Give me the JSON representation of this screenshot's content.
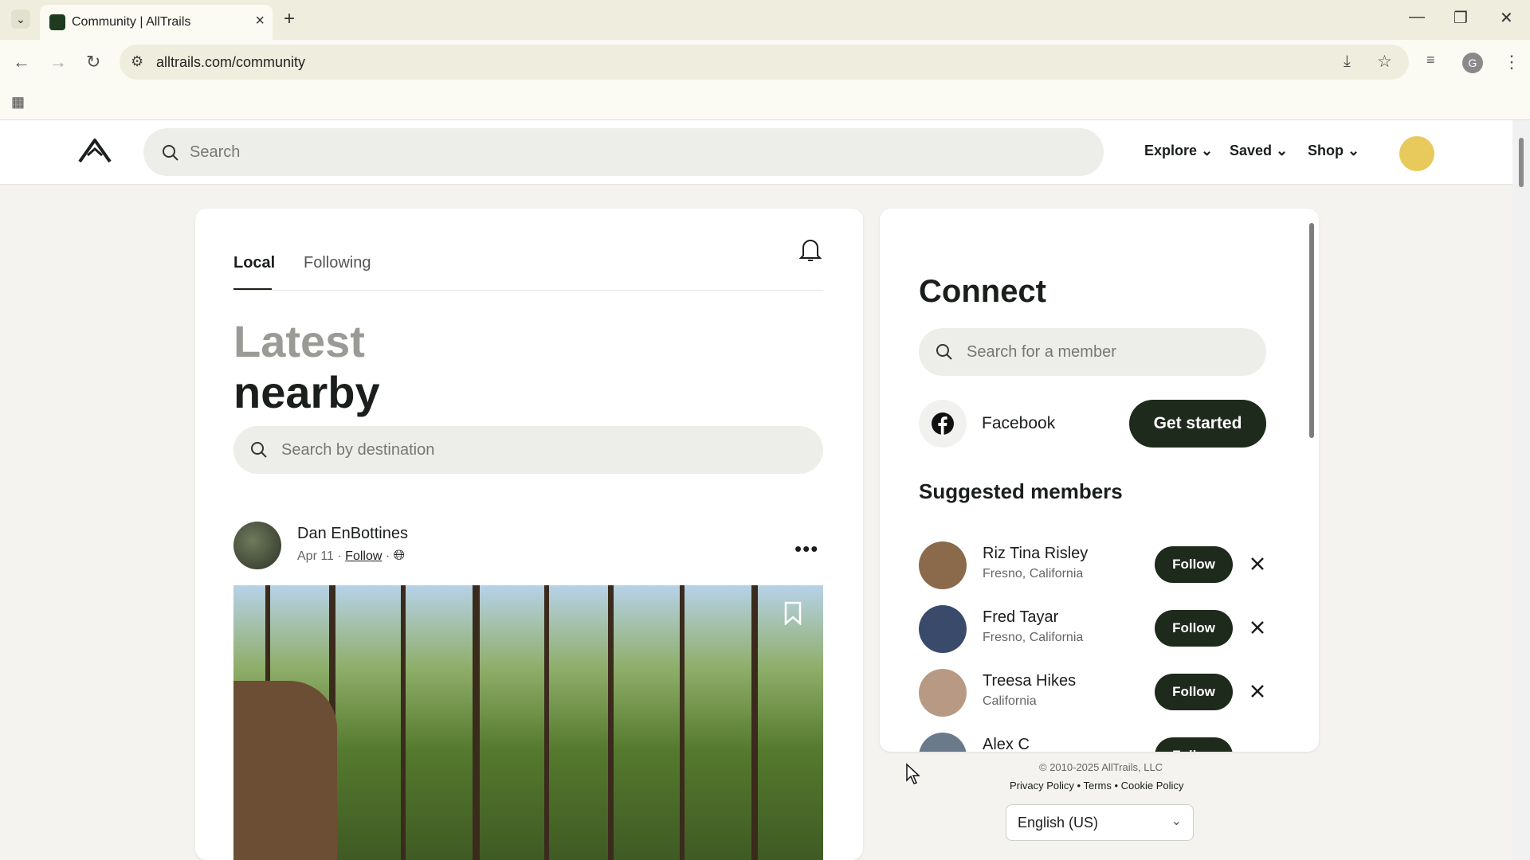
{
  "browser": {
    "tab_title": "Community | AllTrails",
    "url": "alltrails.com/community",
    "profile_initial": "G"
  },
  "header": {
    "search_placeholder": "Search",
    "nav": [
      "Explore",
      "Saved",
      "Shop"
    ]
  },
  "feed": {
    "tabs": [
      "Local",
      "Following"
    ],
    "heading_line1": "Latest",
    "heading_line2": "nearby",
    "destination_placeholder": "Search by destination",
    "post": {
      "author": "Dan EnBottines",
      "date": "Apr 11",
      "follow": "Follow"
    }
  },
  "connect": {
    "title": "Connect",
    "member_search_placeholder": "Search for a member",
    "facebook_label": "Facebook",
    "get_started": "Get started",
    "suggested_title": "Suggested members",
    "follow_label": "Follow",
    "members": [
      {
        "name": "Riz Tina Risley",
        "location": "Fresno, California",
        "avatar_color": "#8a6a4a"
      },
      {
        "name": "Fred Tayar",
        "location": "Fresno, California",
        "avatar_color": "#3a4a6a"
      },
      {
        "name": "Treesa Hikes",
        "location": "California",
        "avatar_color": "#b89a84"
      },
      {
        "name": "Alex C",
        "location": "",
        "avatar_color": "#6a7a8a"
      }
    ]
  },
  "footer": {
    "copyright": "© 2010-2025 AllTrails, LLC",
    "links": [
      "Privacy Policy",
      "Terms",
      "Cookie Policy"
    ],
    "language": "English (US)"
  },
  "colors": {
    "brand_dark": "#1e2a1c",
    "page_bg": "#f4f3ef",
    "chrome_bg": "#efeede"
  }
}
